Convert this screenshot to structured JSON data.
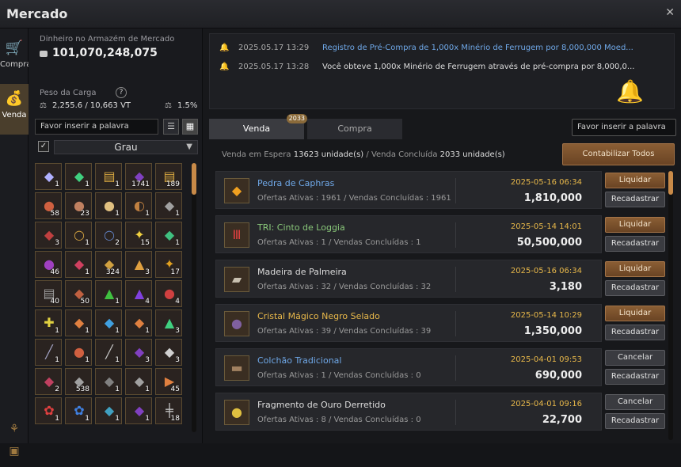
{
  "window": {
    "title": "Mercado",
    "close_icon": "close-icon"
  },
  "left_tabs": [
    {
      "label": "Compra",
      "icon": "cart-icon",
      "active": false
    },
    {
      "label": "Venda",
      "icon": "money-bag-icon",
      "active": true
    }
  ],
  "bottom_icons": [
    "tree-icon",
    "backpack-icon"
  ],
  "storage": {
    "label": "Dinheiro no Armazém de Mercado",
    "value": "101,070,248,075",
    "icon": "silver-icon"
  },
  "weight": {
    "label": "Peso da Carga",
    "value": "2,255.6 / 10,663 VT",
    "percent": "1.5%"
  },
  "left_search": {
    "placeholder": "Favor inserir a palavra"
  },
  "grade_filter": {
    "label": "Grau",
    "checked": true
  },
  "inventory": [
    {
      "glyph": "◆",
      "color": "#b0b0ff",
      "count": "1"
    },
    {
      "glyph": "◆",
      "color": "#40d080",
      "count": "1"
    },
    {
      "glyph": "▤",
      "color": "#d8a840",
      "count": "1"
    },
    {
      "glyph": "◆",
      "color": "#8040c0",
      "count": "1741"
    },
    {
      "glyph": "▤",
      "color": "#d8a840",
      "count": "189"
    },
    {
      "glyph": "●",
      "color": "#d06040",
      "count": "58"
    },
    {
      "glyph": "●",
      "color": "#c08060",
      "count": "23"
    },
    {
      "glyph": "●",
      "color": "#e0c080",
      "count": "1"
    },
    {
      "glyph": "◐",
      "color": "#c08040",
      "count": "1"
    },
    {
      "glyph": "◆",
      "color": "#a0a0a0",
      "count": "1"
    },
    {
      "glyph": "◆",
      "color": "#c04040",
      "count": "3"
    },
    {
      "glyph": "○",
      "color": "#d0a040",
      "count": "1"
    },
    {
      "glyph": "○",
      "color": "#6080c0",
      "count": "2"
    },
    {
      "glyph": "✦",
      "color": "#f0d040",
      "count": "15"
    },
    {
      "glyph": "◆",
      "color": "#40c080",
      "count": "1"
    },
    {
      "glyph": "●",
      "color": "#a040c0",
      "count": "46"
    },
    {
      "glyph": "◆",
      "color": "#d04060",
      "count": "1"
    },
    {
      "glyph": "◆",
      "color": "#d0a040",
      "count": "324"
    },
    {
      "glyph": "▲",
      "color": "#e0a040",
      "count": "3"
    },
    {
      "glyph": "✦",
      "color": "#e0a020",
      "count": "17"
    },
    {
      "glyph": "▤",
      "color": "#a0a0a0",
      "count": "40"
    },
    {
      "glyph": "◆",
      "color": "#c06040",
      "count": "50"
    },
    {
      "glyph": "▲",
      "color": "#40c040",
      "count": "1"
    },
    {
      "glyph": "▲",
      "color": "#8040e0",
      "count": "4"
    },
    {
      "glyph": "●",
      "color": "#d04040",
      "count": "4"
    },
    {
      "glyph": "✚",
      "color": "#e0d040",
      "count": "1"
    },
    {
      "glyph": "◆",
      "color": "#e08040",
      "count": "1"
    },
    {
      "glyph": "◆",
      "color": "#40a0e0",
      "count": "1"
    },
    {
      "glyph": "◆",
      "color": "#e08040",
      "count": "1"
    },
    {
      "glyph": "▲",
      "color": "#40d080",
      "count": "3"
    },
    {
      "glyph": "╱",
      "color": "#a0a0c0",
      "count": "1"
    },
    {
      "glyph": "●",
      "color": "#d06040",
      "count": "1"
    },
    {
      "glyph": "╱",
      "color": "#c0c0c0",
      "count": "1"
    },
    {
      "glyph": "◆",
      "color": "#8040c0",
      "count": "3"
    },
    {
      "glyph": "◆",
      "color": "#d0d0d0",
      "count": "3"
    },
    {
      "glyph": "◆",
      "color": "#c04060",
      "count": "2"
    },
    {
      "glyph": "◆",
      "color": "#a0a0a0",
      "count": "538"
    },
    {
      "glyph": "◆",
      "color": "#808080",
      "count": "1"
    },
    {
      "glyph": "◆",
      "color": "#a0a0a0",
      "count": "1"
    },
    {
      "glyph": "▶",
      "color": "#e08040",
      "count": "45"
    },
    {
      "glyph": "✿",
      "color": "#e04040",
      "count": "1"
    },
    {
      "glyph": "✿",
      "color": "#4080e0",
      "count": "1"
    },
    {
      "glyph": "◆",
      "color": "#40a0c0",
      "count": "1"
    },
    {
      "glyph": "◆",
      "color": "#8040c0",
      "count": "1"
    },
    {
      "glyph": "╪",
      "color": "#c0c0c0",
      "count": "18"
    }
  ],
  "notifications": [
    {
      "time": "2025.05.17 13:29",
      "text": "Registro de Pré-Compra de 1,000x Minério de Ferrugem por 8,000,000 Moed...",
      "highlight": true
    },
    {
      "time": "2025.05.17 13:28",
      "text": "Você obteve 1,000x Minério de Ferrugem através de pré-compra por 8,000,0...",
      "highlight": false
    }
  ],
  "tabs": [
    {
      "label": "Venda",
      "badge": "2033",
      "active": true
    },
    {
      "label": "Compra",
      "badge": "",
      "active": false
    }
  ],
  "right_search": {
    "placeholder": "Favor inserir a palavra"
  },
  "summary": {
    "waiting_label": "Venda em Espera",
    "waiting_value": "13623 unidade(s)",
    "slash": "/",
    "done_label": "Venda Concluída",
    "done_value": "2033 unidade(s)",
    "total_button": "Contabilizar Todos"
  },
  "listings": [
    {
      "name": "Pedra de Caphras",
      "name_color": "blue",
      "icon": "caphras-stone-icon",
      "glyph": "◆",
      "glyph_color": "#f0a020",
      "sub": "Ofertas Ativas : 1961 / Vendas Concluídas : 1961",
      "date": "2025-05-16 06:34",
      "price": "1,810,000",
      "b1": "Liquidar",
      "b1_type": "liq",
      "b2": "Recadastrar"
    },
    {
      "name": "TRI: Cinto de Loggia",
      "name_color": "green",
      "icon": "belt-icon",
      "glyph": "Ⅲ",
      "glyph_color": "#e04040",
      "sub": "Ofertas Ativas : 1 / Vendas Concluídas : 1",
      "date": "2025-05-14 14:01",
      "price": "50,500,000",
      "b1": "Liquidar",
      "b1_type": "liq",
      "b2": "Recadastrar"
    },
    {
      "name": "Madeira de Palmeira",
      "name_color": "white",
      "icon": "palm-wood-icon",
      "glyph": "▰",
      "glyph_color": "#c8c0b0",
      "sub": "Ofertas Ativas : 32 / Vendas Concluídas : 32",
      "date": "2025-05-16 06:34",
      "price": "3,180",
      "b1": "Liquidar",
      "b1_type": "liq",
      "b2": "Recadastrar"
    },
    {
      "name": "Cristal Mágico Negro Selado",
      "name_color": "gold",
      "icon": "black-crystal-icon",
      "glyph": "●",
      "glyph_color": "#8060a0",
      "sub": "Ofertas Ativas : 39 / Vendas Concluídas : 39",
      "date": "2025-05-14 10:29",
      "price": "1,350,000",
      "b1": "Liquidar",
      "b1_type": "liq",
      "b2": "Recadastrar"
    },
    {
      "name": "Colchão Tradicional",
      "name_color": "blue",
      "icon": "mattress-icon",
      "glyph": "▬",
      "glyph_color": "#a08060",
      "sub": "Ofertas Ativas : 1 / Vendas Concluídas : 0",
      "date": "2025-04-01 09:53",
      "price": "690,000",
      "b1": "Cancelar",
      "b1_type": "",
      "b2": "Recadastrar"
    },
    {
      "name": "Fragmento de Ouro Derretido",
      "name_color": "white",
      "icon": "gold-fragment-icon",
      "glyph": "●",
      "glyph_color": "#e0c040",
      "sub": "Ofertas Ativas : 8 / Vendas Concluídas : 0",
      "date": "2025-04-01 09:16",
      "price": "22,700",
      "b1": "Cancelar",
      "b1_type": "",
      "b2": "Recadastrar"
    }
  ]
}
